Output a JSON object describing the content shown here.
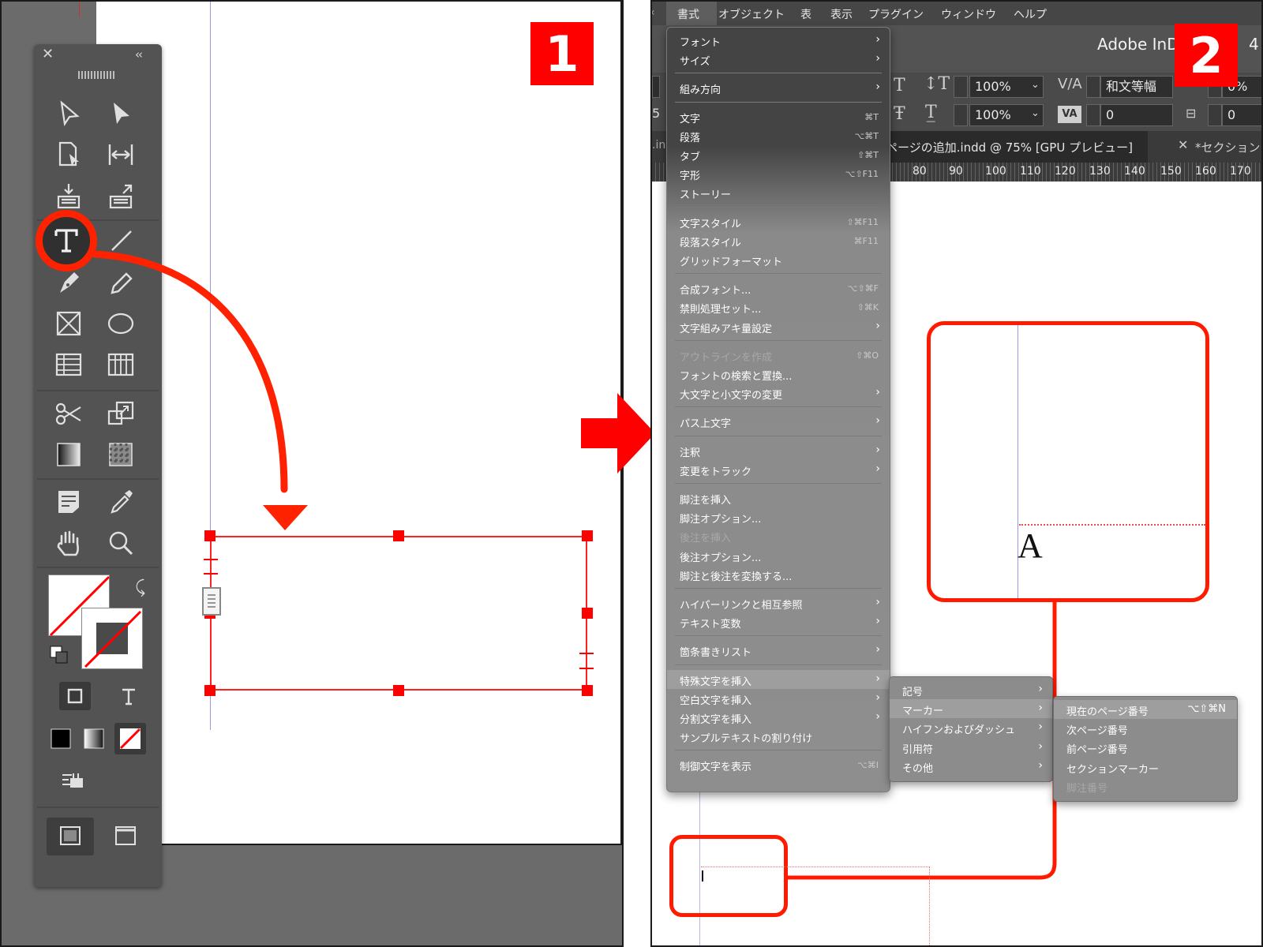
{
  "step1": {
    "badge": "1",
    "toolbox": {
      "close_glyph": "✕",
      "collapse_glyph": "‹‹"
    }
  },
  "step2": {
    "badge": "2",
    "menubar": {
      "items": [
        "書式",
        "オブジェクト",
        "表",
        "表示",
        "プラグイン",
        "ウィンドウ",
        "ヘルプ"
      ]
    },
    "app_title": "Adobe InDe",
    "app_title_suffix": "4",
    "control_bar": {
      "leading_scale": "100%",
      "tracking_font": "和文等幅",
      "tracking_value": "0%",
      "baseline_scale": "100%",
      "kerning_value": "0",
      "extra_value": "0"
    },
    "doc_tab": "ページの追加.indd @ 75% [GPU プレビュー]",
    "doc_tab_second": "*セクション",
    "ruler_ticks": [
      "80",
      "90",
      "100",
      "110",
      "120",
      "130",
      "140",
      "150",
      "160",
      "170"
    ],
    "zoom_glyph": "A",
    "type_menu": [
      {
        "label": "フォント",
        "arrow": true
      },
      {
        "label": "サイズ",
        "arrow": true
      },
      {
        "sep": true
      },
      {
        "label": "組み方向",
        "arrow": true
      },
      {
        "sep": true
      },
      {
        "label": "文字",
        "shortcut": "⌘T"
      },
      {
        "label": "段落",
        "shortcut": "⌥⌘T"
      },
      {
        "label": "タブ",
        "shortcut": "⇧⌘T"
      },
      {
        "label": "字形",
        "shortcut": "⌥⇧F11"
      },
      {
        "label": "ストーリー"
      },
      {
        "sep": true
      },
      {
        "label": "文字スタイル",
        "shortcut": "⇧⌘F11"
      },
      {
        "label": "段落スタイル",
        "shortcut": "⌘F11"
      },
      {
        "label": "グリッドフォーマット"
      },
      {
        "sep": true
      },
      {
        "label": "合成フォント...",
        "shortcut": "⌥⇧⌘F"
      },
      {
        "label": "禁則処理セット...",
        "shortcut": "⇧⌘K"
      },
      {
        "label": "文字組みアキ量設定",
        "arrow": true
      },
      {
        "sep": true
      },
      {
        "label": "アウトラインを作成",
        "shortcut": "⇧⌘O",
        "disabled": true
      },
      {
        "label": "フォントの検索と置換..."
      },
      {
        "label": "大文字と小文字の変更",
        "arrow": true
      },
      {
        "sep": true
      },
      {
        "label": "パス上文字",
        "arrow": true
      },
      {
        "sep": true
      },
      {
        "label": "注釈",
        "arrow": true
      },
      {
        "label": "変更をトラック",
        "arrow": true
      },
      {
        "sep": true
      },
      {
        "label": "脚注を挿入"
      },
      {
        "label": "脚注オプション..."
      },
      {
        "label": "後注を挿入",
        "disabled": true
      },
      {
        "label": "後注オプション..."
      },
      {
        "label": "脚注と後注を変換する..."
      },
      {
        "sep": true
      },
      {
        "label": "ハイパーリンクと相互参照",
        "arrow": true
      },
      {
        "label": "テキスト変数",
        "arrow": true
      },
      {
        "sep": true
      },
      {
        "label": "箇条書きリスト",
        "arrow": true
      },
      {
        "sep": true
      },
      {
        "label": "特殊文字を挿入",
        "arrow": true,
        "highlight": true
      },
      {
        "label": "空白文字を挿入",
        "arrow": true
      },
      {
        "label": "分割文字を挿入",
        "arrow": true
      },
      {
        "label": "サンプルテキストの割り付け"
      },
      {
        "sep": true
      },
      {
        "label": "制御文字を表示",
        "shortcut": "⌥⌘I"
      }
    ],
    "special_menu": [
      {
        "label": "記号",
        "arrow": true
      },
      {
        "label": "マーカー",
        "arrow": true,
        "highlight": true
      },
      {
        "label": "ハイフンおよびダッシュ",
        "arrow": true
      },
      {
        "label": "引用符",
        "arrow": true
      },
      {
        "label": "その他",
        "arrow": true
      }
    ],
    "marker_menu": [
      {
        "label": "現在のページ番号",
        "shortcut": "⌥⇧⌘N",
        "highlight": true
      },
      {
        "label": "次ページ番号"
      },
      {
        "label": "前ページ番号"
      },
      {
        "label": "セクションマーカー"
      },
      {
        "label": "脚注番号",
        "disabled": true
      }
    ]
  },
  "colors": {
    "accent_red": "#ff1a00",
    "menu_bg": "#8c8c8c",
    "toolbox_bg": "#535353"
  }
}
